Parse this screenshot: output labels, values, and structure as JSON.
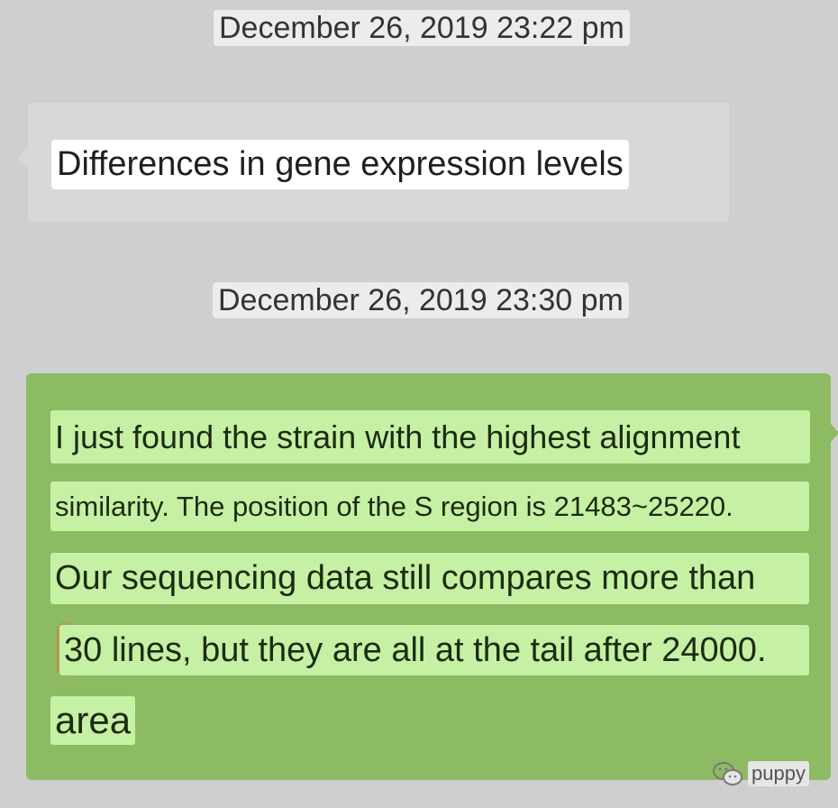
{
  "messages": [
    {
      "timestamp": "December 26, 2019 23:22 pm",
      "direction": "incoming",
      "text": "Differences in gene expression levels"
    },
    {
      "timestamp": "December 26, 2019 23:30 pm",
      "direction": "outgoing",
      "lines": [
        "I just found the strain with the highest alignment",
        "similarity. The position of the S region is 21483~25220.",
        "Our sequencing data still compares more than",
        "30 lines, but they are all at the tail after 24000.",
        "area"
      ]
    }
  ],
  "watermark": {
    "icon": "wechat-icon",
    "label": "puppy"
  },
  "colors": {
    "background": "#cfcfcf",
    "incoming_bubble": "#d8d8d8",
    "outgoing_bubble": "#8cbb63",
    "outgoing_highlight": "#c6f0a4",
    "timestamp_bg": "#ececec"
  }
}
